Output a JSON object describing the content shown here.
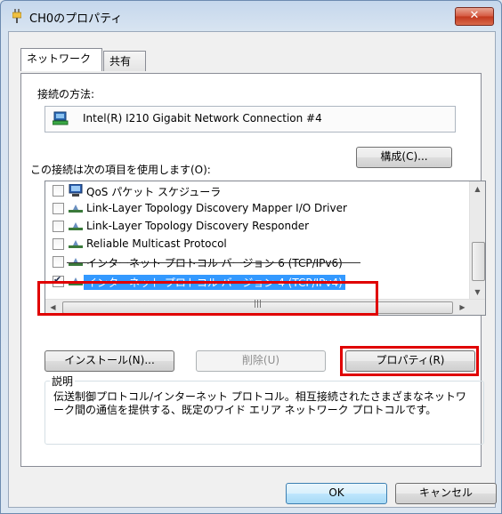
{
  "window": {
    "title": "CH0のプロパティ",
    "close_label": "✕"
  },
  "tabs": [
    {
      "label": "ネットワーク",
      "active": true
    },
    {
      "label": "共有",
      "active": false
    }
  ],
  "connect_using_label": "接続の方法:",
  "adapter_name": "Intel(R) I210 Gigabit Network Connection #4",
  "configure_label": "構成(C)...",
  "items_label": "この接続は次の項目を使用します(O):",
  "items": [
    {
      "label": "QoS パケット スケジューラ",
      "checked": false,
      "icon": "qos-scheduler-icon"
    },
    {
      "label": "Link-Layer Topology Discovery Mapper I/O Driver",
      "checked": false,
      "icon": "network-protocol-icon"
    },
    {
      "label": "Link-Layer Topology Discovery Responder",
      "checked": false,
      "icon": "network-protocol-icon"
    },
    {
      "label": "Reliable Multicast Protocol",
      "checked": false,
      "icon": "network-protocol-icon"
    },
    {
      "label": "インターネット プロトコル バージョン 6 (TCP/IPv6)",
      "checked": false,
      "icon": "network-protocol-icon"
    },
    {
      "label": "インターネット プロトコル バージョン 4 (TCP/IPv4)",
      "checked": true,
      "selected": true,
      "icon": "network-protocol-icon"
    }
  ],
  "scroll_grip": "|||",
  "buttons": {
    "install": "インストール(N)...",
    "uninstall": "削除(U)",
    "properties": "プロパティ(R)"
  },
  "description": {
    "title": "説明",
    "text": "伝送制御プロトコル/インターネット プロトコル。相互接続されたさまざまなネットワーク間の通信を提供する、既定のワイド エリア ネットワーク プロトコルです。"
  },
  "footer": {
    "ok": "OK",
    "cancel": "キャンセル"
  },
  "highlight_color": "#e00000",
  "selection_color": "#3399ff"
}
